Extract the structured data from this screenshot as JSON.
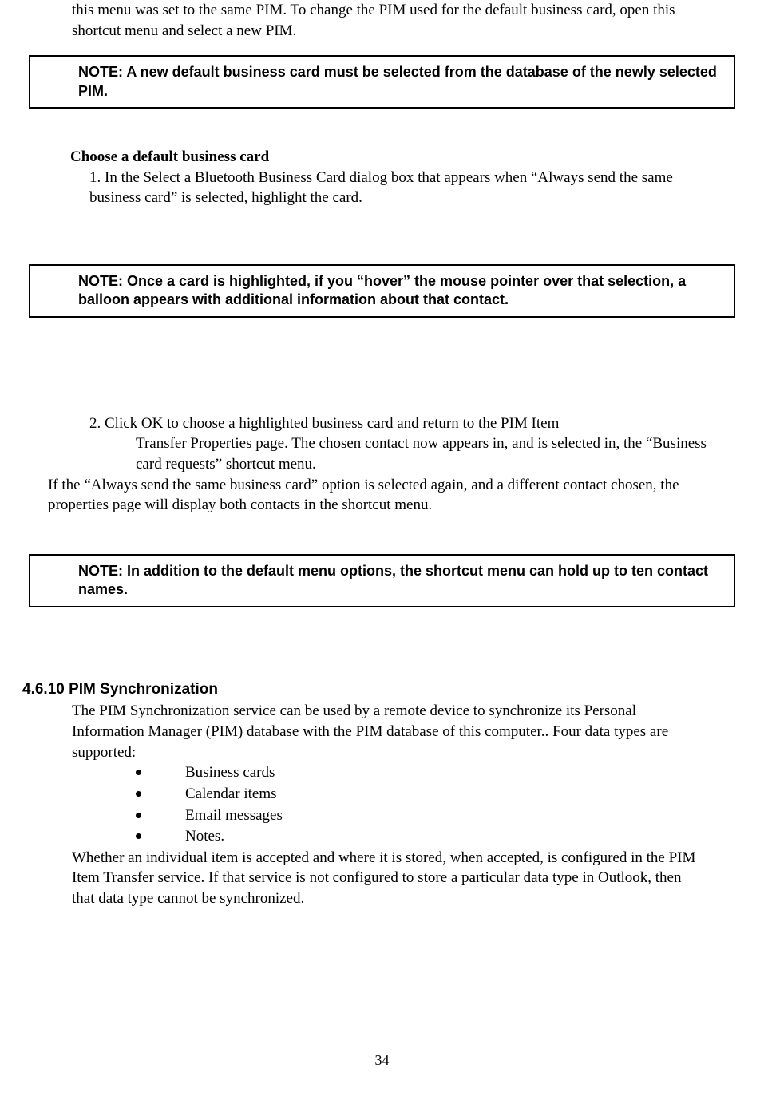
{
  "intro": "this menu was set to the same PIM. To change the PIM used for the default business card, open this shortcut menu and select a new PIM.",
  "note1": "NOTE: A new default business card must be selected from the database of the newly selected PIM.",
  "chooseHeading": "Choose a default business card",
  "step1": "1. In the Select a Bluetooth Business Card dialog box that appears when “Always send the same business card” is selected, highlight the card.",
  "note2": "NOTE: Once a card is highlighted, if you “hover” the mouse pointer over that selection, a balloon appears with additional information about that contact.",
  "step2line1": "2. Click OK to choose a highlighted business card and return to the PIM Item",
  "step2line2": "Transfer Properties page. The chosen contact now appears in, and is selected in, the “Business card requests” shortcut menu.",
  "afterStepsPara": "If the “Always send the same business card” option is selected again, and a different contact chosen, the properties page will display both contacts in the shortcut menu.",
  "note3": "NOTE: In addition to the default menu options, the shortcut menu can hold up to ten contact names.",
  "pimHeading": "4.6.10 PIM Synchronization",
  "pimBody1": "The PIM Synchronization service can be used by a remote device to synchronize its Personal Information Manager (PIM) database with the PIM database of this computer.. Four data types are supported:",
  "bullets": {
    "b1": "Business cards",
    "b2": "Calendar items",
    "b3": "Email messages",
    "b4": "Notes."
  },
  "pimBody2": "Whether an individual item is accepted and where it is stored, when accepted, is configured in the PIM Item Transfer service. If that service is not configured to store a particular data type in Outlook, then that data type cannot be synchronized.",
  "pageNumber": "34"
}
